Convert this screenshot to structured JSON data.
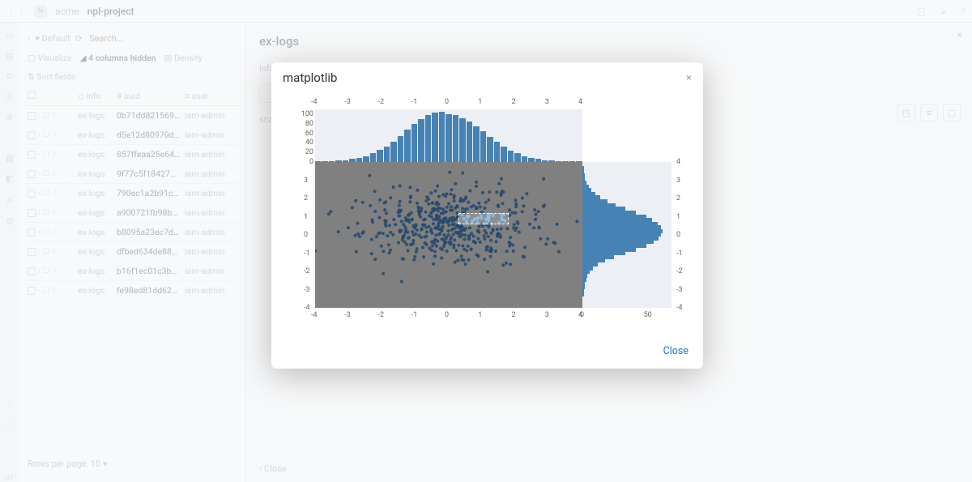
{
  "topbar": {
    "workspace_initial": "N",
    "workspace": "acme",
    "project": "npl-project"
  },
  "table_panel": {
    "view_name": "Default",
    "search_placeholder": "Search...",
    "opts": {
      "visualize": "Visualize",
      "hidden_cols": "4 columns hidden",
      "density": "Density",
      "sort": "Sort fields"
    },
    "head": {
      "info": "info",
      "uuid": "uuid",
      "user": "user"
    },
    "rows": [
      {
        "info": "ex-logs",
        "uuid": "0b71dd821569…",
        "user": "iam-admin"
      },
      {
        "info": "ex-logs",
        "uuid": "d5e12d80970d…",
        "user": "iam-admin"
      },
      {
        "info": "ex-logs",
        "uuid": "857ffeaa25e64…",
        "user": "iam-admin"
      },
      {
        "info": "ex-logs",
        "uuid": "9f77c5f18427…",
        "user": "iam-admin"
      },
      {
        "info": "ex-logs",
        "uuid": "790ec1a2b91c…",
        "user": "iam-admin"
      },
      {
        "info": "ex-logs",
        "uuid": "a900721fb98b…",
        "user": "iam-admin"
      },
      {
        "info": "ex-logs",
        "uuid": "b8095a23ec7d…",
        "user": "iam-admin"
      },
      {
        "info": "ex-logs",
        "uuid": "dfbed634de88…",
        "user": "iam-admin"
      },
      {
        "info": "ex-logs",
        "uuid": "b16f1ec01c3b…",
        "user": "iam-admin"
      },
      {
        "info": "ex-logs",
        "uuid": "fe98ed81dd62…",
        "user": "iam-admin"
      }
    ],
    "footer": {
      "rows_per_page": "Rows per page: 10"
    }
  },
  "detail_panel": {
    "title": "ex-logs",
    "tabs": {
      "info": "info"
    },
    "partial_label": "sca",
    "close": "Close"
  },
  "modal": {
    "title": "matplotlib",
    "close": "Close"
  },
  "chart_data": [
    {
      "type": "scatter",
      "title": "",
      "xlabel": "",
      "ylabel": "",
      "xlim": [
        -4,
        4
      ],
      "ylim": [
        -4,
        4
      ],
      "x_ticks": [
        -4,
        -3,
        -2,
        -1,
        0,
        1,
        2,
        3,
        4
      ],
      "y_ticks": [
        -4,
        -3,
        -2,
        -1,
        0,
        1,
        2,
        3
      ],
      "selection_rect": {
        "x0": 0.3,
        "x1": 1.8,
        "y0": 0.6,
        "y1": 1.2
      },
      "n_points_approx": 500,
      "distribution_note": "2D roughly-normal cloud, x-mean≈0, y-mean≈0.5, sd_x≈1.3, sd_y≈1.0"
    },
    {
      "type": "bar",
      "orientation": "vertical",
      "role": "marginal-top-histogram",
      "bin_edges": [
        -4,
        -3.8,
        -3.6,
        -3.4,
        -3.2,
        -3,
        -2.8,
        -2.6,
        -2.4,
        -2.2,
        -2,
        -1.8,
        -1.6,
        -1.4,
        -1.2,
        -1,
        -0.8,
        -0.6,
        -0.4,
        -0.2,
        0,
        0.2,
        0.4,
        0.6,
        0.8,
        1,
        1.2,
        1.4,
        1.6,
        1.8,
        2,
        2.2,
        2.4,
        2.6,
        2.8,
        3,
        3.2,
        3.4,
        3.6,
        3.8,
        4
      ],
      "values": [
        1,
        2,
        2,
        3,
        4,
        6,
        8,
        12,
        18,
        25,
        32,
        42,
        55,
        68,
        80,
        90,
        98,
        104,
        105,
        100,
        98,
        92,
        85,
        75,
        64,
        52,
        42,
        32,
        24,
        18,
        12,
        8,
        6,
        4,
        3,
        2,
        2,
        1,
        1
      ],
      "ylim": [
        0,
        110
      ],
      "y_ticks": [
        0,
        20,
        40,
        60,
        80,
        100
      ]
    },
    {
      "type": "bar",
      "orientation": "horizontal",
      "role": "marginal-right-histogram",
      "bin_edges": [
        -4,
        -3.8,
        -3.6,
        -3.4,
        -3.2,
        -3,
        -2.8,
        -2.6,
        -2.4,
        -2.2,
        -2,
        -1.8,
        -1.6,
        -1.4,
        -1.2,
        -1,
        -0.8,
        -0.6,
        -0.4,
        -0.2,
        0,
        0.2,
        0.4,
        0.6,
        0.8,
        1,
        1.2,
        1.4,
        1.6,
        1.8,
        2,
        2.2,
        2.4,
        2.6,
        2.8,
        3,
        3.2,
        3.4,
        3.6,
        3.8,
        4
      ],
      "values": [
        0,
        0,
        0,
        1,
        1,
        2,
        2,
        3,
        4,
        6,
        8,
        12,
        18,
        25,
        34,
        42,
        50,
        56,
        60,
        62,
        63,
        62,
        59,
        55,
        50,
        42,
        34,
        26,
        20,
        14,
        10,
        7,
        5,
        3,
        2,
        2,
        1,
        1,
        0
      ],
      "xlim": [
        0,
        70
      ],
      "x_ticks": [
        0,
        50
      ],
      "y_ticks": [
        -4,
        -3,
        -2,
        -1,
        0,
        1,
        2,
        3,
        4
      ]
    }
  ]
}
